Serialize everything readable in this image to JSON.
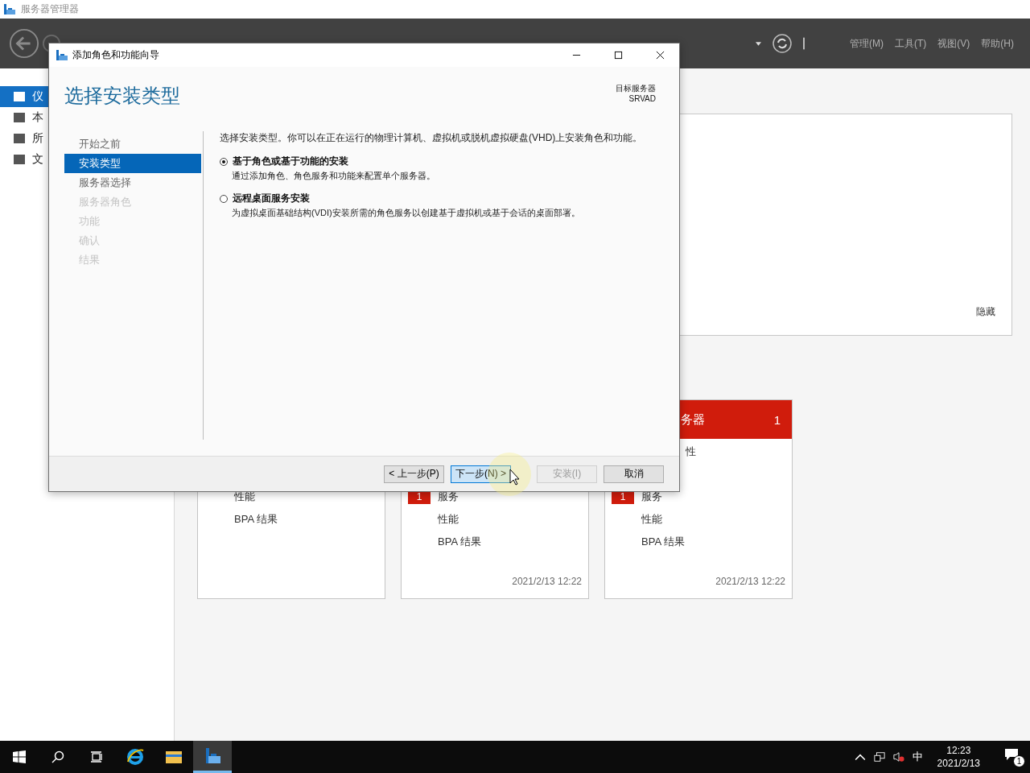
{
  "app_title": "服务器管理器",
  "header": {
    "menus": [
      "管理(M)",
      "工具(T)",
      "视图(V)",
      "帮助(H)"
    ]
  },
  "sidebar": {
    "items": [
      {
        "label": "仪",
        "selected": true
      },
      {
        "label": "本",
        "selected": false
      },
      {
        "label": "所",
        "selected": false
      },
      {
        "label": "文",
        "selected": false
      }
    ]
  },
  "welcome_panel": {
    "hide_link": "隐藏"
  },
  "tiles": [
    {
      "rows": [
        {
          "label": "性能",
          "kind": "plain"
        },
        {
          "label": "BPA 结果",
          "kind": "plain"
        }
      ]
    },
    {
      "rows": [
        {
          "label": "服务",
          "kind": "plain",
          "badge": "1"
        },
        {
          "label": "性能",
          "kind": "plain"
        },
        {
          "label": "BPA 结果",
          "kind": "plain"
        }
      ],
      "timestamp": "2021/2/13 12:22"
    },
    {
      "title": "务器",
      "count": "1",
      "rows": [
        {
          "label": "性",
          "kind": "partial"
        },
        {
          "label": "服务",
          "kind": "plain",
          "badge": "1"
        },
        {
          "label": "性能",
          "kind": "plain"
        },
        {
          "label": "BPA 结果",
          "kind": "plain"
        }
      ],
      "timestamp": "2021/2/13 12:22"
    }
  ],
  "dialog": {
    "title": "添加角色和功能向导",
    "heading": "选择安装类型",
    "target_label": "目标服务器",
    "target_value": "SRVAD",
    "steps": [
      {
        "label": "开始之前",
        "selected": false,
        "disabled": false
      },
      {
        "label": "安装类型",
        "selected": true,
        "disabled": false
      },
      {
        "label": "服务器选择",
        "selected": false,
        "disabled": false
      },
      {
        "label": "服务器角色",
        "selected": false,
        "disabled": true
      },
      {
        "label": "功能",
        "selected": false,
        "disabled": true
      },
      {
        "label": "确认",
        "selected": false,
        "disabled": true
      },
      {
        "label": "结果",
        "selected": false,
        "disabled": true
      }
    ],
    "intro": "选择安装类型。你可以在正在运行的物理计算机、虚拟机或脱机虚拟硬盘(VHD)上安装角色和功能。",
    "options": [
      {
        "label": "基于角色或基于功能的安装",
        "description": "通过添加角色、角色服务和功能来配置单个服务器。",
        "selected": true
      },
      {
        "label": "远程桌面服务安装",
        "description": "为虚拟桌面基础结构(VDI)安装所需的角色服务以创建基于虚拟机或基于会话的桌面部署。",
        "selected": false
      }
    ],
    "buttons": [
      {
        "label": "< 上一步(P)",
        "disabled": false,
        "focused": false
      },
      {
        "label": "下一步(N) >",
        "disabled": false,
        "focused": true
      },
      {
        "label": "安装(I)",
        "disabled": true,
        "focused": false
      },
      {
        "label": "取消",
        "disabled": false,
        "focused": false
      }
    ]
  },
  "taskbar": {
    "apps": [
      {
        "kind": "ie",
        "selected": false
      },
      {
        "kind": "explorer",
        "selected": false
      },
      {
        "kind": "server-manager",
        "selected": true
      }
    ],
    "ime": "中",
    "time": "12:23",
    "date": "2021/2/13",
    "notification_count": "1"
  }
}
